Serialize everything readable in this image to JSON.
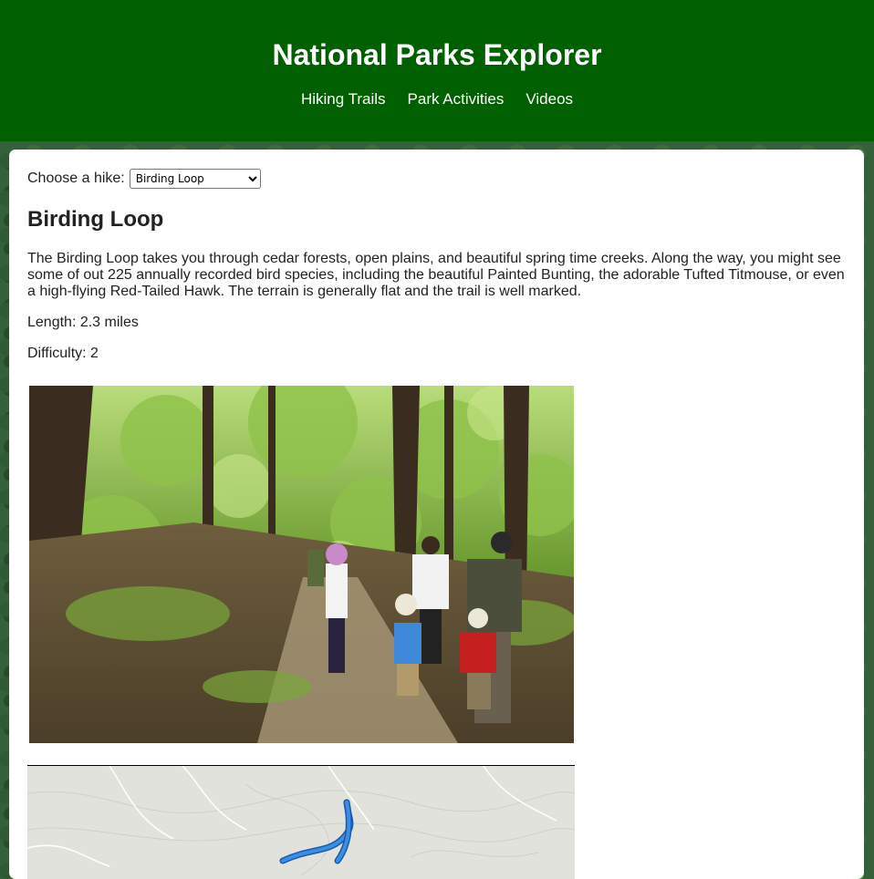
{
  "header": {
    "title": "National Parks Explorer",
    "nav": [
      "Hiking Trails",
      "Park Activities",
      "Videos"
    ]
  },
  "chooser": {
    "label": "Choose a hike:",
    "selected": "Birding Loop"
  },
  "hike": {
    "name": "Birding Loop",
    "description": "The Birding Loop takes you through cedar forests, open plains, and beautiful spring time creeks. Along the way, you might see some of out 225 annually recorded bird species, including the beautiful Painted Bunting, the adorable Tufted Titmouse, or even a high-flying Red-Tailed Hawk. The terrain is generally flat and the trail is well marked.",
    "length": "Length: 2.3 miles",
    "difficulty": "Difficulty: 2"
  },
  "colors": {
    "header_bg": "#006000",
    "trail_line": "#3a8ee6"
  }
}
